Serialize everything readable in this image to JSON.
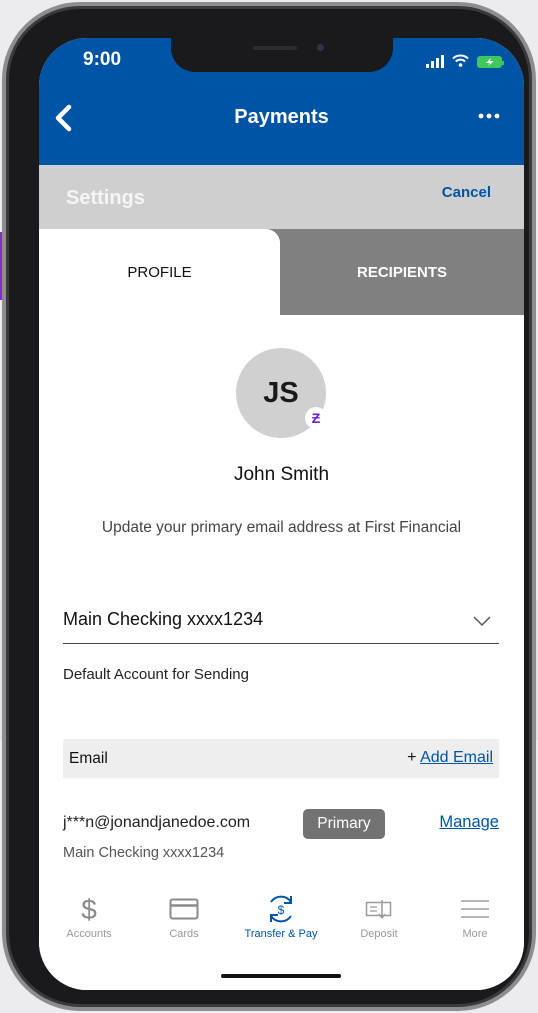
{
  "status_bar": {
    "time": "9:00"
  },
  "header": {
    "title": "Payments"
  },
  "settings_bar": {
    "title": "Settings",
    "cancel_label": "Cancel"
  },
  "tabs": [
    {
      "label": "PROFILE",
      "active": true
    },
    {
      "label": "RECIPIENTS",
      "active": false
    }
  ],
  "profile": {
    "initials": "JS",
    "badge_glyph": "Ƶ",
    "name": "John Smith",
    "update_email_text": "Update your primary email address at First Financial"
  },
  "account_select": {
    "value": "Main Checking xxxx1234",
    "hint": "Default Account for Sending"
  },
  "email_section": {
    "header_label": "Email",
    "add_prefix": "+ ",
    "add_label": "Add Email",
    "entries": [
      {
        "address": "j***n@jonandjanedoe.com",
        "badge": "Primary",
        "manage_label": "Manage",
        "account": "Main Checking xxxx1234"
      }
    ]
  },
  "tab_bar": {
    "items": [
      {
        "label": "Accounts",
        "icon": "dollar-icon",
        "active": false
      },
      {
        "label": "Cards",
        "icon": "card-icon",
        "active": false
      },
      {
        "label": "Transfer & Pay",
        "icon": "transfer-pay-icon",
        "active": true
      },
      {
        "label": "Deposit",
        "icon": "check-deposit-icon",
        "active": false
      },
      {
        "label": "More",
        "icon": "menu-icon",
        "active": false
      }
    ]
  },
  "colors": {
    "brand_blue": "#0054a6",
    "callout_purple": "#7b2fd0",
    "battery_green": "#3ec75a",
    "zelle_purple": "#6d1ed4"
  }
}
